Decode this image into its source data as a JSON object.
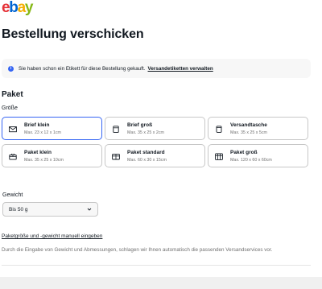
{
  "logo": {
    "e": "e",
    "b": "b",
    "a": "a",
    "y": "y",
    "colors": {
      "e": "#e53238",
      "b": "#0064d2",
      "a": "#f5af02",
      "y": "#86b817"
    }
  },
  "page_title": "Bestellung verschicken",
  "notice": {
    "icon": "info-icon",
    "text": "Sie haben schon ein Etikett für diese Bestellung gekauft.",
    "link": "Versandetiketten verwalten"
  },
  "package": {
    "section_title": "Paket",
    "size_label": "Größe",
    "options": [
      {
        "name": "Brief klein",
        "dims": "Max. 23 x 12 x 1cm",
        "icon": "envelope-icon",
        "selected": true
      },
      {
        "name": "Brief groß",
        "dims": "Max. 35 x 25 x 2cm",
        "icon": "large-letter-icon",
        "selected": false
      },
      {
        "name": "Versandtasche",
        "dims": "Max. 35 x 25 x 5cm",
        "icon": "mailer-bag-icon",
        "selected": false
      },
      {
        "name": "Paket klein",
        "dims": "Max. 35 x 25 x 10cm",
        "icon": "small-box-icon",
        "selected": false
      },
      {
        "name": "Paket standard",
        "dims": "Max. 60 x 30 x 15cm",
        "icon": "standard-box-icon",
        "selected": false
      },
      {
        "name": "Paket groß",
        "dims": "Max. 120 x 60 x 60cm",
        "icon": "large-box-icon",
        "selected": false
      }
    ]
  },
  "weight": {
    "label": "Gewicht",
    "selected": "Bis 50 g"
  },
  "manual_link": "Paketgröße und -gewicht manuell eingeben",
  "hint": "Durch die Eingabe von Gewicht und Abmessungen, schlagen wir Ihnen automatisch die passenden Versandservices vor.",
  "accent_color": "#3665f3"
}
